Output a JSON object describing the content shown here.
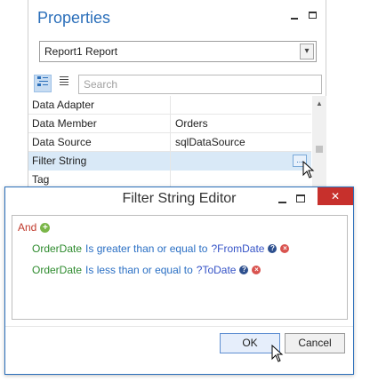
{
  "properties_panel": {
    "title": "Properties",
    "object_selector": "Report1  Report",
    "search_placeholder": "Search",
    "rows": [
      {
        "name": "Data Adapter",
        "value": ""
      },
      {
        "name": "Data Member",
        "value": "Orders"
      },
      {
        "name": "Data Source",
        "value": "sqlDataSource"
      },
      {
        "name": "Filter String",
        "value": "",
        "selected": true
      },
      {
        "name": "Tag",
        "value": ""
      }
    ],
    "ellipsis_label": "..."
  },
  "dialog": {
    "title": "Filter String Editor",
    "group_operator": "And",
    "conditions": [
      {
        "field": "OrderDate",
        "operator": "Is greater than or equal to",
        "value": "?FromDate"
      },
      {
        "field": "OrderDate",
        "operator": "Is less than or equal to",
        "value": "?ToDate"
      }
    ],
    "ok_label": "OK",
    "cancel_label": "Cancel",
    "close_glyph": "✕"
  },
  "icons": {
    "categorized": "categorized-view-icon",
    "alphabetical": "alphabetical-list-icon",
    "add": "add-condition-icon",
    "help": "help-icon",
    "remove": "remove-condition-icon"
  },
  "colors": {
    "accent": "#2b6fba",
    "close_button": "#c7302c",
    "operator_group": "#c0392b",
    "field_name": "#2e8b2e",
    "condition_op": "#2a6fc4",
    "parameter": "#3553c7"
  }
}
